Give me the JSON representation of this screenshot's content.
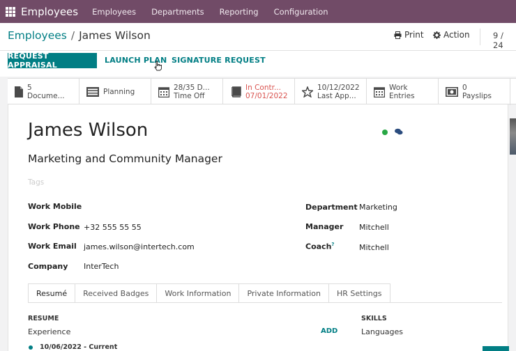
{
  "nav": {
    "brand": "Employees",
    "items": [
      "Employees",
      "Departments",
      "Reporting",
      "Configuration"
    ]
  },
  "breadcrumb": {
    "parent": "Employees",
    "separator": "/",
    "current": "James Wilson"
  },
  "toolbar": {
    "print": "Print",
    "action": "Action",
    "pager": "9 / 24"
  },
  "actions": {
    "request_appraisal": "REQUEST APPRAISAL",
    "launch_plan": "LAUNCH PLAN",
    "signature_request": "SIGNATURE REQUEST"
  },
  "smart_buttons": [
    {
      "icon": "document-icon",
      "line1": "5",
      "line2": "Docume..."
    },
    {
      "icon": "planning-icon",
      "line1": "Planning",
      "line2": ""
    },
    {
      "icon": "calendar-icon",
      "line1": "28/35 D...",
      "line2": "Time Off"
    },
    {
      "icon": "book-icon",
      "line1": "In Contr...",
      "line2": "07/01/2022",
      "alert": true
    },
    {
      "icon": "star-icon",
      "line1": "10/12/2022",
      "line2": "Last App..."
    },
    {
      "icon": "calendar-icon",
      "line1": "Work",
      "line2": "Entries"
    },
    {
      "icon": "money-icon",
      "line1": "0",
      "line2": "Payslips"
    }
  ],
  "employee": {
    "name": "James Wilson",
    "job_title": "Marketing and Community Manager",
    "tags_placeholder": "Tags",
    "status_color": "#28a745"
  },
  "fields_left": [
    {
      "label": "Work Mobile",
      "value": ""
    },
    {
      "label": "Work Phone",
      "value": "+32 555 55 55"
    },
    {
      "label": "Work Email",
      "value": "james.wilson@intertech.com"
    },
    {
      "label": "Company",
      "value": "InterTech"
    }
  ],
  "fields_right": [
    {
      "label": "Department",
      "value": "Marketing"
    },
    {
      "label": "Manager",
      "value": "Mitchell"
    },
    {
      "label": "Coach",
      "sup": "?",
      "value": "Mitchell"
    }
  ],
  "tabs": [
    "Resumé",
    "Received Badges",
    "Work Information",
    "Private Information",
    "HR Settings"
  ],
  "resume": {
    "header": "RESUME",
    "subheader": "Experience",
    "add": "ADD",
    "first_date": "10/06/2022 - Current"
  },
  "skills": {
    "header": "SKILLS",
    "subheader": "Languages"
  },
  "colors": {
    "nav": "#714b67",
    "accent": "#017e84",
    "alert": "#d9534f"
  }
}
